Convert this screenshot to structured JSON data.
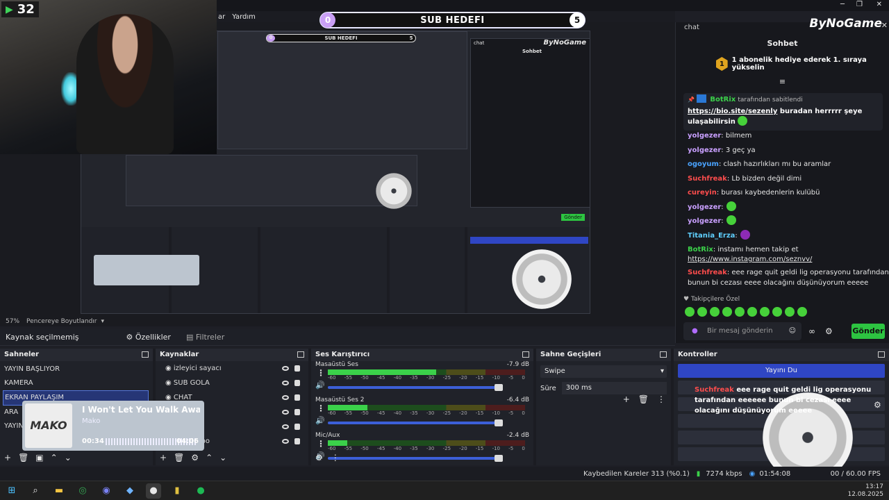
{
  "window": {
    "menu_help": "Yardım",
    "menu_partial": "ar",
    "win_min": "─",
    "win_max": "❐",
    "win_close": "✕"
  },
  "goal": {
    "current": "0",
    "title": "SUB HEDEFI",
    "target": "5"
  },
  "webcam": {
    "counter": "32"
  },
  "nested_preview": {
    "goal_title": "SUB HEDEFI",
    "goal_current": "0",
    "goal_target": "5",
    "chat_brand": "ByNoGame",
    "chat_label": "chat",
    "chat_title": "Sohbet",
    "send": "Gönder"
  },
  "chat": {
    "label": "chat",
    "brand": "ByNoGame",
    "close": "✕",
    "title": "Sohbet",
    "gift_rank": "1",
    "gift_text": "1 abonelik hediye ederek 1. sıraya yükselin",
    "pinned_by": "BotRix",
    "pinned_suffix": "tarafından sabitlendi",
    "pinned_link": "https://bio.site/sezenly",
    "pinned_text": " buradan herrrrr şeye",
    "pinned_text2": "ulaşabilirsin",
    "messages": [
      {
        "user": "yolgezer",
        "text": ": bilmem",
        "color": "#c9a0ff"
      },
      {
        "user": "yolgezer",
        "text": ": 3 geç ya",
        "color": "#c9a0ff"
      },
      {
        "user": "ogoyum",
        "text": ": clash hazırlıkları mı bu aramlar",
        "color": "#4aa3ff"
      },
      {
        "user": "Suchfreak",
        "text": ": Lb bizden değil dimi",
        "color": "#ff4d4d"
      },
      {
        "user": "cureyin",
        "text": ": burası kaybedenlerin kulübü",
        "color": "#ff4d4d"
      },
      {
        "user": "yolgezer",
        "text": ":",
        "color": "#c9a0ff"
      },
      {
        "user": "yolgezer",
        "text": ":",
        "color": "#c9a0ff"
      },
      {
        "user": "Titania_Erza",
        "text": ":",
        "color": "#5fd0ff"
      },
      {
        "user": "BotRix",
        "text": ": instamı hemen takip et",
        "color": "#3bd14a"
      }
    ],
    "insta_link": "https://www.instagram.com/seznvv/",
    "last_user": "Suchfreak",
    "last_text1": ": eee rage quit geldi lig operasyonu tarafından eeeeee",
    "last_text2": "bunun bi cezası eeee olacağını düşünüyorum eeeee",
    "followers_label": "Takipçilere Özel",
    "input_placeholder": "Bir mesaj gönderin",
    "send": "Gönder"
  },
  "status_row": {
    "zoom": "57%",
    "fit": "Pencereye Boyutlandır"
  },
  "source_bar": {
    "none_selected": "Kaynak seçilmemiş",
    "properties": "Özellikler",
    "filters": "Filtreler"
  },
  "scenes": {
    "title": "Sahneler",
    "items": [
      "YAYIN BAŞLIYOR",
      "KAMERA",
      "EKRAN PAYLAŞIM",
      "ARA",
      "YAYIN"
    ]
  },
  "sources": {
    "title": "Kaynaklar",
    "items": [
      "izleyici sayacı",
      "SUB GOLA",
      "CHAT",
      "",
      "",
      "sssssss.po"
    ]
  },
  "mixer": {
    "title": "Ses Karıştırıcı",
    "channels": [
      {
        "name": "Masaüstü Ses",
        "db": "-7.9 dB",
        "level": 0.55
      },
      {
        "name": "Masaüstü Ses 2",
        "db": "-6.4 dB",
        "level": 0.2
      },
      {
        "name": "Mic/Aux",
        "db": "-2.4 dB",
        "level": 0.1
      }
    ],
    "scale": [
      "-60",
      "-55",
      "-50",
      "-45",
      "-40",
      "-35",
      "-30",
      "-25",
      "-20",
      "-15",
      "-10",
      "-5",
      "0"
    ]
  },
  "transitions": {
    "title": "Sahne Geçişleri",
    "selected": "Swipe",
    "duration_label": "Süre",
    "duration": "300 ms"
  },
  "controls": {
    "title": "Kontroller",
    "active_button": "Yayını Du",
    "overlay_user": "Suchfreak",
    "overlay_text": " eee rage quit geldi lig operasyonu tarafından eeeeee bunun bi cezası eeee olacağını düşünüyorum eeeee"
  },
  "music": {
    "cover": "MAKO",
    "title": "I Won't Let You Walk Away (f",
    "artist": "Mako",
    "elapsed": "00:34",
    "duration": "04:06"
  },
  "statusbar": {
    "dropped": "Kaybedilen Kareler 313 (%0.1)",
    "bitrate": "7274 kbps",
    "rec_time": "01:54:08",
    "fps": "00 / 60.00 FPS"
  },
  "tray": {
    "time": "13:17",
    "date": "12.08.2025"
  },
  "icons": [
    "windows-icon",
    "search-icon",
    "folder-icon",
    "chrome-icon",
    "discord-icon",
    "app-icon",
    "obs-icon",
    "shell-icon",
    "spotify-icon"
  ]
}
